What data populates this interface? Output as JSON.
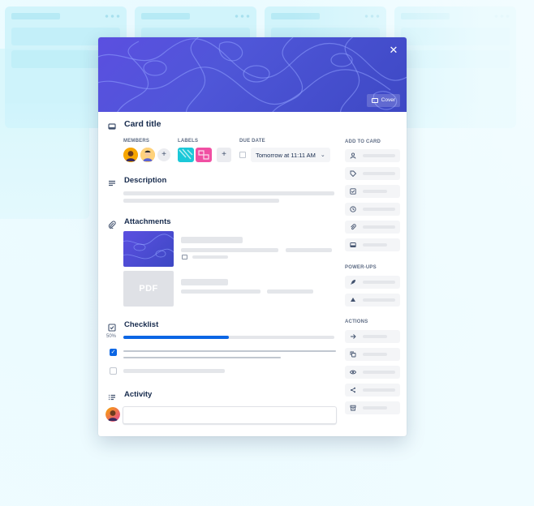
{
  "card": {
    "title": "Card title",
    "close_icon": "close-icon",
    "cover_button": "Cover",
    "colors": {
      "cover": "#5b4fe0",
      "accent": "#0c66e4",
      "label_cyan": "#1bc8d8",
      "label_pink": "#f04fa3"
    }
  },
  "fields": {
    "members_label": "MEMBERS",
    "labels_label": "LABELS",
    "due_label": "DUE DATE",
    "due_value": "Tomorrow at 11:11 AM",
    "add_icon": "+"
  },
  "sections": {
    "description": "Description",
    "attachments": "Attachments",
    "checklist": "Checklist",
    "activity": "Activity"
  },
  "attachments": {
    "pdf_label": "PDF"
  },
  "checklist": {
    "progress_text": "50%",
    "progress": 0.5,
    "items": [
      {
        "checked": true
      },
      {
        "checked": false
      }
    ]
  },
  "sidebar": {
    "add_to_card": "ADD TO CARD",
    "power_ups": "POWER-UPS",
    "actions": "ACTIONS",
    "add_to_card_icons": [
      "person-icon",
      "tag-icon",
      "checklist-icon",
      "clock-icon",
      "paperclip-icon",
      "cover-icon"
    ],
    "power_up_icons": [
      "rocket-icon",
      "drive-icon"
    ],
    "action_icons": [
      "arrow-right-icon",
      "copy-icon",
      "eye-icon",
      "share-icon",
      "archive-icon"
    ]
  }
}
